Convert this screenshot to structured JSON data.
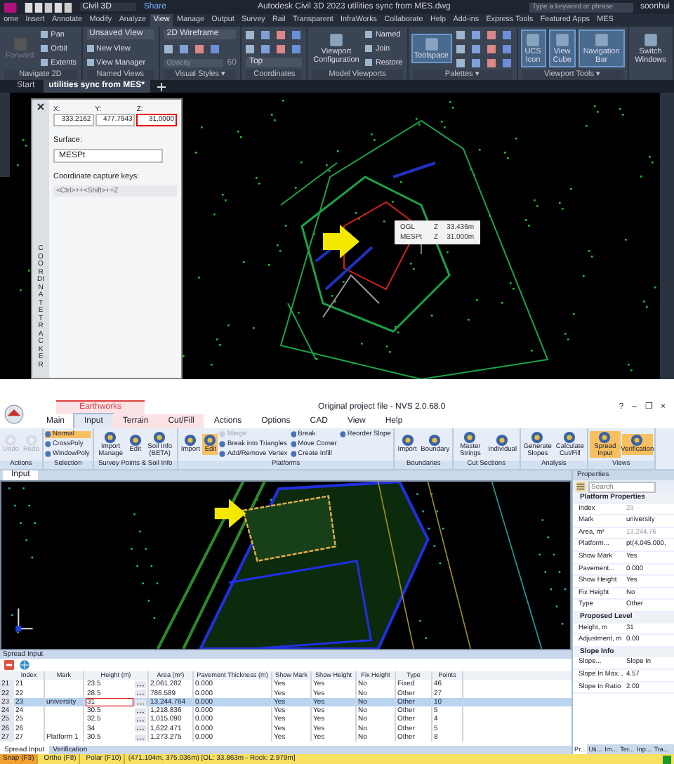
{
  "cad_window": {
    "workspace": "Civil 3D",
    "share": "Share",
    "title": "Autodesk Civil 3D 2023   utilities sync from MES.dwg",
    "search": {
      "placeholder": "Type a keyword or phrase"
    },
    "user": "soonhui",
    "tabs": [
      {
        "label": "ome",
        "selected": false
      },
      {
        "label": "Insert",
        "selected": false
      },
      {
        "label": "Annotate",
        "selected": false
      },
      {
        "label": "Modify",
        "selected": false
      },
      {
        "label": "Analyze",
        "selected": false
      },
      {
        "label": "View",
        "selected": true
      },
      {
        "label": "Manage",
        "selected": false
      },
      {
        "label": "Output",
        "selected": false
      },
      {
        "label": "Survey",
        "selected": false
      },
      {
        "label": "Rail",
        "selected": false
      },
      {
        "label": "Transparent",
        "selected": false
      },
      {
        "label": "InfraWorks",
        "selected": false
      },
      {
        "label": "Collaborate",
        "selected": false
      },
      {
        "label": "Help",
        "selected": false
      },
      {
        "label": "Add-ins",
        "selected": false
      },
      {
        "label": "Express Tools",
        "selected": false
      },
      {
        "label": "Featured Apps",
        "selected": false
      },
      {
        "label": "MES",
        "selected": false
      }
    ],
    "ribbon": [
      {
        "label": "Navigate 2D",
        "items": [
          {
            "kind": "large",
            "label": "Forward",
            "disabled": true
          },
          {
            "kind": "small",
            "label": "Pan"
          },
          {
            "kind": "small",
            "label": "Orbit"
          },
          {
            "kind": "small",
            "label": "Extents"
          }
        ]
      },
      {
        "label": "Named Views",
        "items": [
          {
            "kind": "dropdown",
            "label": "Unsaved View"
          },
          {
            "kind": "small",
            "label": "New View"
          },
          {
            "kind": "small",
            "label": "View Manager"
          }
        ]
      },
      {
        "label": "Visual Styles ▾",
        "items": [
          {
            "kind": "dropdown",
            "label": "2D Wireframe"
          },
          {
            "kind": "icons"
          },
          {
            "kind": "field",
            "placeholder": "Opacity",
            "value": "60"
          }
        ]
      },
      {
        "label": "Coordinates",
        "items": [
          {
            "kind": "icons"
          },
          {
            "kind": "icons"
          },
          {
            "kind": "dropdown",
            "label": "Top"
          }
        ]
      },
      {
        "label": "Model Viewports",
        "items": [
          {
            "kind": "large",
            "label": "Viewport Configuration"
          },
          {
            "kind": "small",
            "label": "Named"
          },
          {
            "kind": "small",
            "label": "Join"
          },
          {
            "kind": "small",
            "label": "Restore"
          }
        ]
      },
      {
        "label": "Palettes ▾",
        "items": [
          {
            "kind": "large",
            "label": "Toolspace",
            "selected": true
          },
          {
            "kind": "icons"
          },
          {
            "kind": "icons"
          },
          {
            "kind": "icons"
          }
        ]
      },
      {
        "label": "Viewport Tools ▾",
        "items": [
          {
            "kind": "large",
            "label": "UCS Icon",
            "selected": true
          },
          {
            "kind": "large",
            "label": "View Cube",
            "selected": true
          },
          {
            "kind": "large",
            "label": "Navigation Bar",
            "selected": true
          }
        ]
      },
      {
        "items": [
          {
            "kind": "large",
            "label": "Switch Windows"
          }
        ]
      }
    ],
    "file_tabs": [
      {
        "label": "Start",
        "selected": false
      },
      {
        "label": "utilities sync from MES*",
        "selected": true
      }
    ],
    "tracker": {
      "fields": [
        {
          "label": "X:",
          "value": "333.2162",
          "highlighted": false
        },
        {
          "label": "Y:",
          "value": "477.7943",
          "highlighted": false
        },
        {
          "label": "Z:",
          "value": "31.0000",
          "highlighted": true
        }
      ],
      "surface_label": "Surface:",
      "surface": "MESPt",
      "keys_label": "Coordinate capture keys:",
      "keys": "<Ctrl>++<Shift>++Z",
      "title": "COORDINATE TRACKER"
    },
    "tooltip": [
      {
        "name": "OGL",
        "axis": "Z",
        "value": "33.436m"
      },
      {
        "name": "MESPt",
        "axis": "Z",
        "value": "31.000m"
      }
    ]
  },
  "nvs_window": {
    "context_group": "Earthworks",
    "title": "Original project file - NVS 2.0.68.0",
    "tabs": [
      {
        "label": "Main",
        "selected": false,
        "context": false
      },
      {
        "label": "Input",
        "selected": true,
        "context": true
      },
      {
        "label": "Terrain",
        "selected": false,
        "context": true
      },
      {
        "label": "Cut/Fill",
        "selected": false,
        "context": true
      },
      {
        "label": "Actions",
        "selected": false,
        "context": false
      },
      {
        "label": "Options",
        "selected": false,
        "context": false
      },
      {
        "label": "CAD",
        "selected": false,
        "context": false
      },
      {
        "label": "View",
        "selected": false,
        "context": false
      },
      {
        "label": "Help",
        "selected": false,
        "context": false
      }
    ],
    "window_controls": [
      "?",
      "–",
      "❐",
      "×"
    ],
    "ribbon": [
      {
        "label": "Actions",
        "items": [
          {
            "kind": "large",
            "label": "Undo",
            "disabled": true
          },
          {
            "kind": "large",
            "label": "Redo",
            "disabled": true
          }
        ]
      },
      {
        "label": "Selection",
        "items": [
          {
            "kind": "small",
            "label": "Normal",
            "selected": true
          },
          {
            "kind": "small",
            "label": "CrossPoly"
          },
          {
            "kind": "small",
            "label": "WindowPoly"
          }
        ]
      },
      {
        "label": "Survey Points & Soil Info",
        "items": [
          {
            "kind": "large",
            "label": "Import Manage"
          },
          {
            "kind": "large",
            "label": "Edit"
          },
          {
            "kind": "large",
            "label": "Soil Info (BETA)"
          }
        ]
      },
      {
        "label": "Platforms",
        "items": [
          {
            "kind": "large",
            "label": "Import"
          },
          {
            "kind": "large",
            "label": "Edit",
            "selected": true
          },
          {
            "kind": "small",
            "label": "Merge",
            "disabled": true
          },
          {
            "kind": "small",
            "label": "Break into Triangles"
          },
          {
            "kind": "small",
            "label": "Add/Remove Vertex"
          },
          {
            "kind": "small",
            "label": "Break"
          },
          {
            "kind": "small",
            "label": "Move Corner"
          },
          {
            "kind": "small",
            "label": "Create Infill"
          },
          {
            "kind": "small",
            "label": "Reorder Slope"
          }
        ]
      },
      {
        "label": "Boundaries",
        "items": [
          {
            "kind": "large",
            "label": "Import"
          },
          {
            "kind": "large",
            "label": "Boundary"
          }
        ]
      },
      {
        "label": "Cut Sections",
        "items": [
          {
            "kind": "large",
            "label": "Master Strings"
          },
          {
            "kind": "large",
            "label": "Individual"
          }
        ]
      },
      {
        "label": "Analysis",
        "items": [
          {
            "kind": "large",
            "label": "Generate Slopes"
          },
          {
            "kind": "large",
            "label": "Calculate Cut/Fill"
          }
        ]
      },
      {
        "label": "Views",
        "items": [
          {
            "kind": "large",
            "label": "Spread Input",
            "selected": true
          },
          {
            "kind": "large",
            "label": "Verification",
            "selected": true
          }
        ]
      }
    ],
    "doc_tab": "Input",
    "spread": {
      "title": "Spread Input",
      "columns": [
        "Index",
        "Mark",
        "Height (m)",
        "Area (m²)",
        "Pavement Thickness (m)",
        "Show Mark",
        "Show Height",
        "Fix Height",
        "Type",
        "Points"
      ],
      "rows": [
        {
          "number": "21",
          "cells": [
            "21",
            "",
            "23.5",
            "2,061.282",
            "0.000",
            "Yes",
            "Yes",
            "No",
            "Fixed",
            "46"
          ],
          "selected": false,
          "annotated": false
        },
        {
          "number": "22",
          "cells": [
            "22",
            "",
            "28.5",
            "786.589",
            "0.000",
            "Yes",
            "Yes",
            "No",
            "Other",
            "27"
          ],
          "selected": false,
          "annotated": false
        },
        {
          "number": "23",
          "cells": [
            "23",
            "university",
            "31",
            "13,244.764",
            "0.000",
            "Yes",
            "Yes",
            "No",
            "Other",
            "10"
          ],
          "selected": true,
          "annotated": true
        },
        {
          "number": "24",
          "cells": [
            "24",
            "",
            "30.5",
            "1,218.836",
            "0.000",
            "Yes",
            "Yes",
            "No",
            "Other",
            "5"
          ],
          "selected": false,
          "annotated": false
        },
        {
          "number": "25",
          "cells": [
            "25",
            "",
            "32.5",
            "1,015.090",
            "0.000",
            "Yes",
            "Yes",
            "No",
            "Other",
            "4"
          ],
          "selected": false,
          "annotated": false
        },
        {
          "number": "26",
          "cells": [
            "26",
            "",
            "34",
            "1,622.471",
            "0.000",
            "Yes",
            "Yes",
            "No",
            "Other",
            "5"
          ],
          "selected": false,
          "annotated": false
        },
        {
          "number": "27",
          "cells": [
            "27",
            "Platform 1",
            "30.5",
            "1,273.275",
            "0.000",
            "Yes",
            "Yes",
            "No",
            "Other",
            "8"
          ],
          "selected": false,
          "annotated": false
        }
      ],
      "tabs": [
        {
          "label": "Spread Input",
          "selected": true
        },
        {
          "label": "Verification",
          "selected": false
        }
      ]
    },
    "properties": {
      "title": "Properties",
      "search": {
        "placeholder": "Search"
      },
      "rows": [
        {
          "kind": "section",
          "name": "Platform Properties"
        },
        {
          "kind": "prop",
          "name": "Index",
          "value": "23",
          "readonly": true
        },
        {
          "kind": "prop",
          "name": "Mark",
          "value": "university",
          "readonly": false
        },
        {
          "kind": "prop",
          "name": "Area, m²",
          "value": "13,244.76",
          "readonly": true
        },
        {
          "kind": "prop",
          "name": "Platform...",
          "value": "pt(4,045.000,",
          "readonly": false
        },
        {
          "kind": "prop",
          "name": "Show Mark",
          "value": "Yes",
          "readonly": false
        },
        {
          "kind": "prop",
          "name": "Pavement...",
          "value": "0.000",
          "readonly": false
        },
        {
          "kind": "prop",
          "name": "Show Height",
          "value": "Yes",
          "readonly": false
        },
        {
          "kind": "prop",
          "name": "Fix Height",
          "value": "No",
          "readonly": false
        },
        {
          "kind": "prop",
          "name": "Type",
          "value": "Other",
          "readonly": false
        },
        {
          "kind": "section",
          "name": "Proposed Level"
        },
        {
          "kind": "prop",
          "name": "Height, m",
          "value": "31",
          "readonly": false
        },
        {
          "kind": "prop",
          "name": "Adjustment, m",
          "value": "0.00",
          "readonly": false
        },
        {
          "kind": "section",
          "name": "Slope Info"
        },
        {
          "kind": "prop",
          "name": "Slope...",
          "value": "Slope In",
          "readonly": false
        },
        {
          "kind": "prop",
          "name": "Slope In Max...",
          "value": "4.57",
          "readonly": false
        },
        {
          "kind": "prop",
          "name": "Slope In Ratio",
          "value": "2.00",
          "readonly": false
        }
      ],
      "tabs": [
        {
          "label": "Pr...",
          "selected": true
        },
        {
          "label": "Uti...",
          "selected": false
        },
        {
          "label": "Im...",
          "selected": false
        },
        {
          "label": "Ter...",
          "selected": false
        },
        {
          "label": "Inp...",
          "selected": false
        },
        {
          "label": "Tra...",
          "selected": false
        }
      ]
    },
    "status": {
      "toggles": [
        {
          "label": "Snap (F3)",
          "on": true
        },
        {
          "label": "Ortho (F8)",
          "on": false
        },
        {
          "label": "Polar (F10)",
          "on": false
        }
      ],
      "coordinates": "(471.104m, 375.036m) [OL: 33.863m - Rock: 2.979m]"
    }
  }
}
